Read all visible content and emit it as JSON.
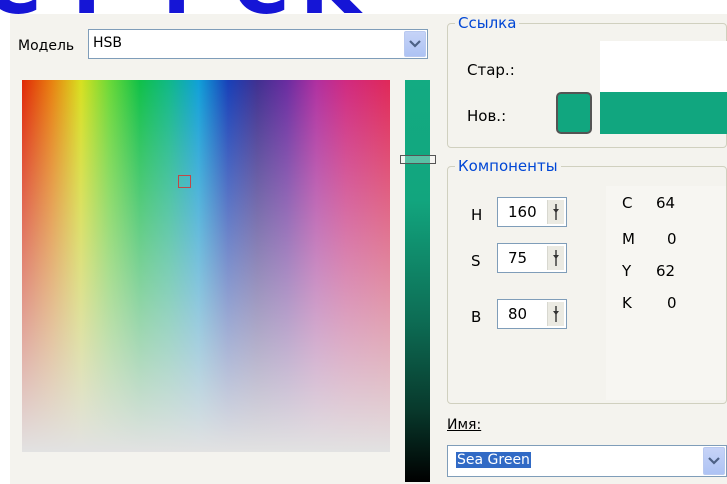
{
  "banner_glyphs": [
    "C",
    "T",
    "T",
    "C",
    "K"
  ],
  "model": {
    "label": "Модель",
    "value": "HSB"
  },
  "reference": {
    "group_title": "Ссылка",
    "old_label": "Стар.:",
    "new_label": "Нов.:",
    "new_color": "#11a67f"
  },
  "components": {
    "group_title": "Компоненты",
    "hsb": [
      {
        "label": "H",
        "value": "160"
      },
      {
        "label": "S",
        "value": "75"
      },
      {
        "label": "B",
        "value": "80"
      }
    ],
    "cmyk": [
      {
        "label": "C",
        "value": "64"
      },
      {
        "label": "M",
        "value": "0"
      },
      {
        "label": "Y",
        "value": "62"
      },
      {
        "label": "K",
        "value": "0"
      }
    ]
  },
  "name": {
    "label": "Имя:",
    "value": "Sea Green"
  },
  "icons": {
    "dropdown": "chevron-down-icon",
    "spin": "slider-thumb-icon"
  }
}
